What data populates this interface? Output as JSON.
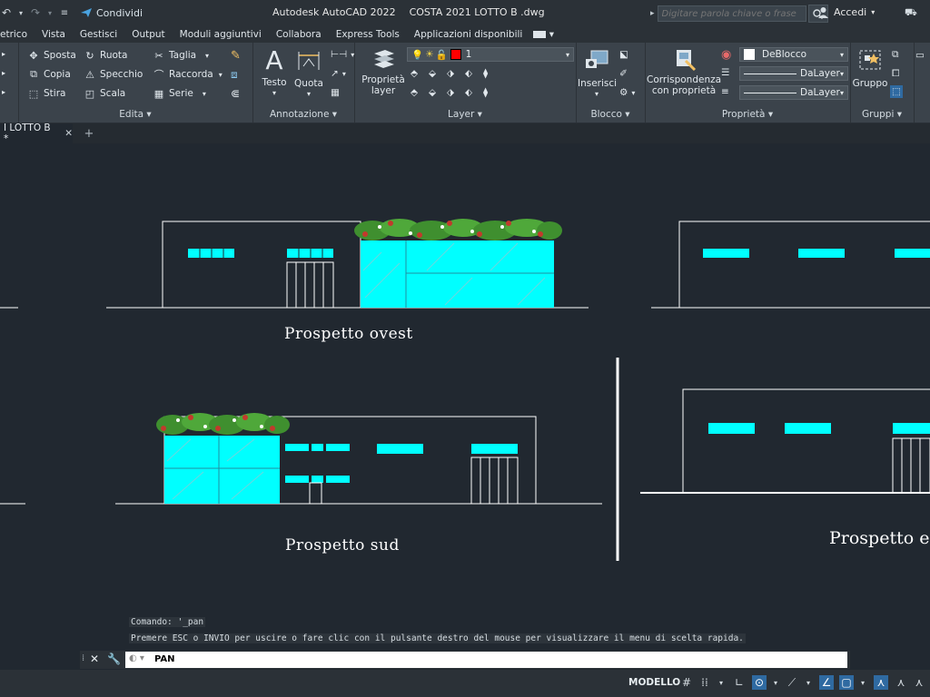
{
  "titlebar": {
    "share_label": "Condividi",
    "app_title": "Autodesk AutoCAD 2022",
    "file_name": "COSTA 2021 LOTTO B .dwg",
    "search_placeholder": "Digitare parola chiave o frase",
    "login_label": "Accedi"
  },
  "menu": {
    "items": [
      "etrico",
      "Vista",
      "Gestisci",
      "Output",
      "Moduli aggiuntivi",
      "Collabora",
      "Express Tools",
      "Applicazioni disponibili"
    ]
  },
  "ribbon": {
    "edita": {
      "title": "Edita",
      "sposta": "Sposta",
      "ruota": "Ruota",
      "taglia": "Taglia",
      "copia": "Copia",
      "specchio": "Specchio",
      "raccorda": "Raccorda",
      "stira": "Stira",
      "scala": "Scala",
      "serie": "Serie"
    },
    "annotazione": {
      "title": "Annotazione",
      "testo": "Testo",
      "quota": "Quota"
    },
    "layer": {
      "title": "Layer",
      "proprieta_layer_1": "Proprietà",
      "proprieta_layer_2": "layer",
      "current_layer": "1"
    },
    "blocco": {
      "title": "Blocco",
      "inserisci": "Inserisci"
    },
    "proprieta": {
      "title": "Proprietà",
      "corrispondenza_1": "Corrispondenza",
      "corrispondenza_2": "con proprietà",
      "color_value": "DeBlocco",
      "linetype_value": "DaLayer",
      "lineweight_value": "DaLayer"
    },
    "gruppi": {
      "title": "Gruppi",
      "gruppo": "Gruppo"
    }
  },
  "doc_tabs": {
    "active_tab": "I LOTTO B *"
  },
  "drawing": {
    "label_ovest": "Prospetto ovest",
    "label_sud": "Prospetto sud",
    "label_est": "Prospetto est"
  },
  "command": {
    "history_1": "Comando: '_pan",
    "history_2": "Premere ESC o INVIO per uscire o fare clic con il pulsante destro del mouse per visualizzare il menu di scelta rapida.",
    "current": "PAN"
  },
  "status": {
    "model_label": "MODELLO"
  },
  "colors": {
    "background": "#212830",
    "window_fill": "#00ffff",
    "accent": "#2f6aa1",
    "layer_color": "#ff0000"
  }
}
